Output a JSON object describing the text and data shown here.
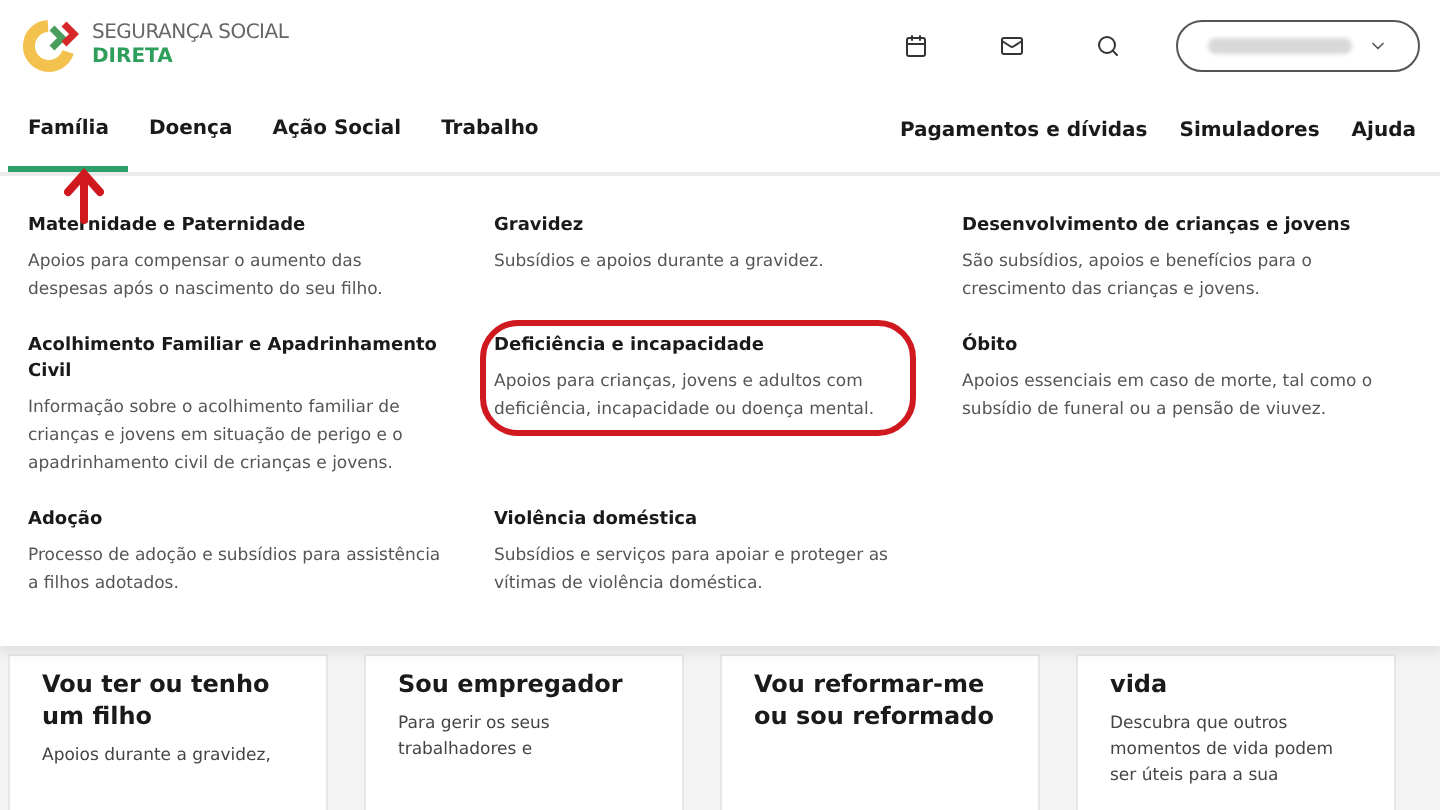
{
  "brand": {
    "line1": "SEGURANÇA SOCIAL",
    "line2": "DIRETA"
  },
  "nav_left": [
    {
      "label": "Família",
      "selected": true
    },
    {
      "label": "Doença",
      "selected": false
    },
    {
      "label": "Ação Social",
      "selected": false
    },
    {
      "label": "Trabalho",
      "selected": false
    }
  ],
  "nav_right": [
    "Pagamentos e dívidas",
    "Simuladores",
    "Ajuda"
  ],
  "menu": [
    {
      "title": "Maternidade e Paternidade",
      "text": "Apoios para compensar o aumento das despesas após o nascimento do seu filho.",
      "highlighted": false
    },
    {
      "title": "Gravidez",
      "text": "Subsídios e apoios durante a gravidez.",
      "highlighted": false
    },
    {
      "title": "Desenvolvimento de crianças e jovens",
      "text": "São subsídios, apoios e benefícios para o crescimento das crianças e jovens.",
      "highlighted": false
    },
    {
      "title": "Acolhimento Familiar e Apadrinhamento Civil",
      "text": "Informação sobre o acolhimento familiar de crianças e jovens em situação de perigo e o apadrinhamento civil de crianças e jovens.",
      "highlighted": false
    },
    {
      "title": "Deficiência e incapacidade",
      "text": "Apoios para crianças, jovens e adultos com deficiência, incapacidade ou doença mental.",
      "highlighted": true
    },
    {
      "title": "Óbito",
      "text": "Apoios essenciais em caso de morte, tal como o subsídio de funeral ou a pensão de viuvez.",
      "highlighted": false
    },
    {
      "title": "Adoção",
      "text": "Processo de adoção e subsídios para assistência a filhos adotados.",
      "highlighted": false
    },
    {
      "title": "Violência doméstica",
      "text": "Subsídios e serviços para apoiar e proteger as vítimas de violência doméstica.",
      "highlighted": false
    }
  ],
  "cards": [
    {
      "title": "Vou ter ou tenho um filho",
      "text": "Apoios durante a gravidez,"
    },
    {
      "title": "Sou empregador",
      "text": "Para gerir os seus trabalhadores e"
    },
    {
      "title": "Vou reformar-me ou sou reformado"
    },
    {
      "title": "vida",
      "text": "Descubra que outros momentos de vida podem ser úteis para a sua"
    }
  ]
}
